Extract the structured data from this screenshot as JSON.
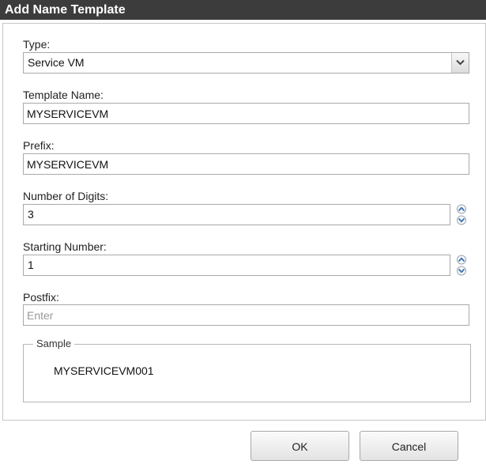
{
  "window": {
    "title": "Add Name Template"
  },
  "form": {
    "type_label": "Type:",
    "type_value": "Service VM",
    "template_name_label": "Template Name:",
    "template_name_value": "MYSERVICEVM",
    "prefix_label": "Prefix:",
    "prefix_value": "MYSERVICEVM",
    "digits_label": "Number of Digits:",
    "digits_value": "3",
    "starting_label": "Starting Number:",
    "starting_value": "1",
    "postfix_label": "Postfix:",
    "postfix_value": "",
    "postfix_placeholder": "Enter"
  },
  "sample": {
    "legend": "Sample",
    "value": "MYSERVICEVM001"
  },
  "buttons": {
    "ok": "OK",
    "cancel": "Cancel"
  },
  "colors": {
    "titlebar": "#3c3c3c",
    "spin_arrow": "#3a6fb0"
  }
}
